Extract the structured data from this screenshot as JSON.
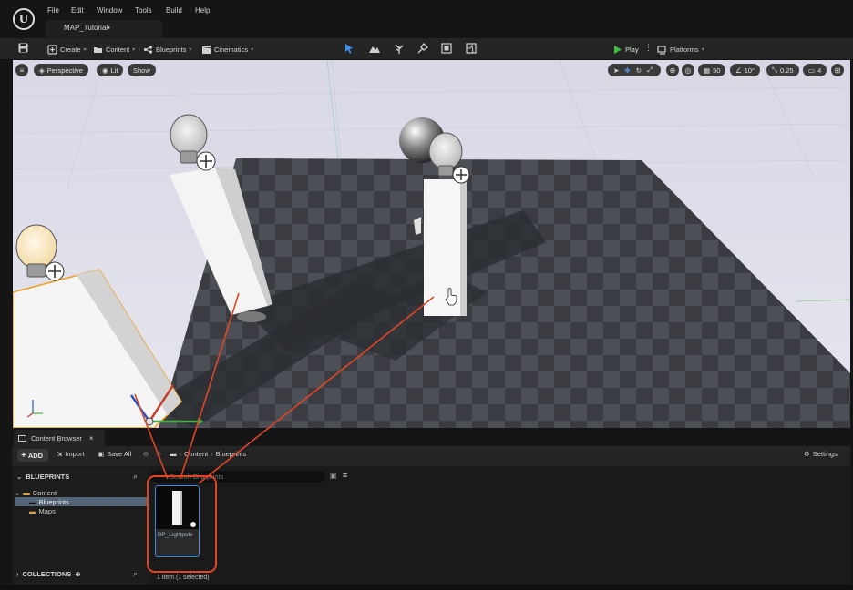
{
  "menu": {
    "items": [
      "File",
      "Edit",
      "Window",
      "Tools",
      "Build",
      "Help"
    ],
    "tab_label": "MAP_Tutorial•"
  },
  "toolbar": {
    "create_label": "Create",
    "content_label": "Content",
    "blueprints_label": "Blueprints",
    "cinematics_label": "Cinematics",
    "play_label": "Play",
    "platforms_label": "Platforms"
  },
  "viewport": {
    "perspective_label": "Perspective",
    "lit_label": "Lit",
    "show_label": "Show",
    "grid_snap_value": "50",
    "rotation_snap_value": "10°",
    "scale_snap_value": "0.25",
    "camera_speed_value": "4"
  },
  "content_browser": {
    "tab_label": "Content Browser",
    "add_label": "ADD",
    "import_label": "Import",
    "save_all_label": "Save All",
    "breadcrumb": [
      "Content",
      "Blueprints"
    ],
    "settings_label": "Settings",
    "sidebar_header": "BLUEPRINTS",
    "tree": {
      "root": "Content",
      "children": [
        "Blueprints",
        "Maps"
      ]
    },
    "collections_label": "COLLECTIONS",
    "search_placeholder": "Search Blueprints",
    "asset_name": "BP_Lightpole",
    "status_text": "1 item (1 selected)"
  },
  "colors": {
    "accent_blue": "#3d86d8",
    "play_green": "#3fbf3f",
    "annotation_red": "#e04525",
    "folder_yellow": "#d9a441",
    "selection_orange": "#f0a020"
  },
  "icons": {
    "ue_logo": "unreal-logo",
    "add": "plus-icon",
    "search": "search-icon",
    "settings": "gear-icon",
    "play": "play-icon"
  }
}
